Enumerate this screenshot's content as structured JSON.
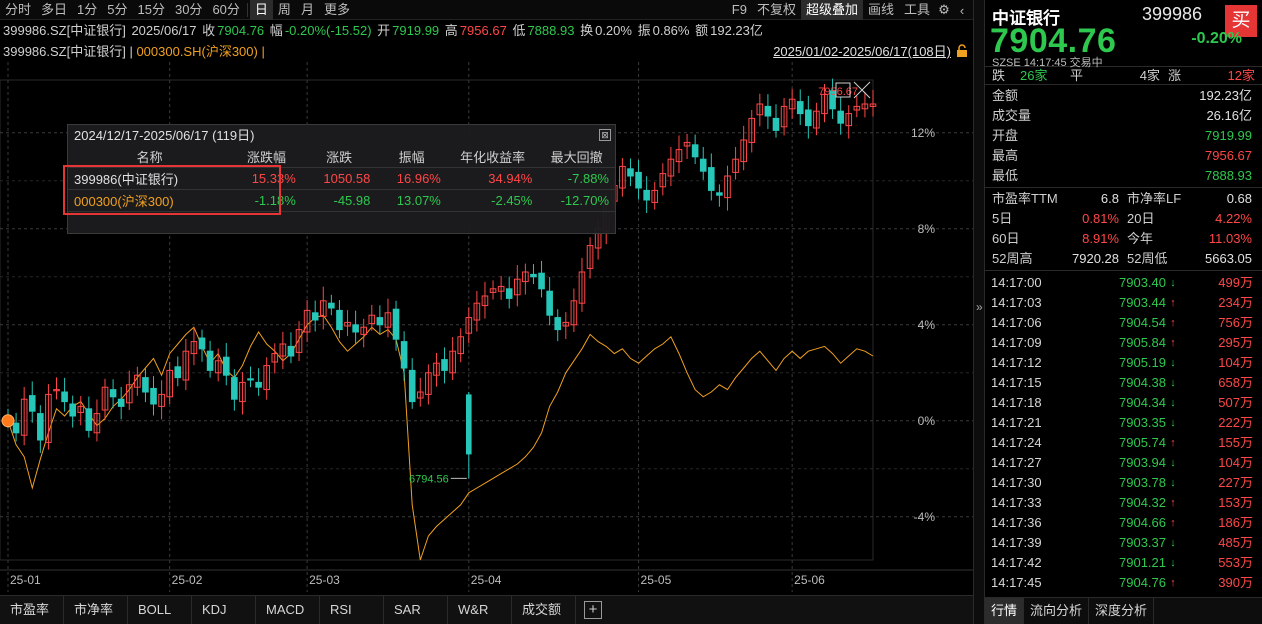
{
  "toolbar": {
    "periods": [
      "分时",
      "多日",
      "1分",
      "5分",
      "15分",
      "30分",
      "60分",
      "日",
      "周",
      "月",
      "更多"
    ],
    "active_period": "日",
    "right_items": [
      "F9",
      "不复权",
      "超级叠加",
      "画线",
      "工具"
    ],
    "active_right": "超级叠加"
  },
  "info": {
    "code": "399986.SZ[中证银行]",
    "date": "2025/06/17",
    "close_label": "收",
    "close_value": "7904.76",
    "change_label": "幅",
    "change_value": "-0.20%(-15.52)",
    "open_label": "开",
    "open_value": "7919.99",
    "high_label": "高",
    "high_value": "7956.67",
    "low_label": "低",
    "low_value": "7888.93",
    "turnover_label": "换",
    "turnover_value": "0.20%",
    "amplitude_label": "振",
    "amplitude_value": "0.86%",
    "amount_label": "额",
    "amount_value": "192.23亿"
  },
  "legend": {
    "main": "399986.SZ[中证银行]",
    "separator": " | ",
    "overlay": "000300.SH(沪深300)",
    "overlay_suffix": " |",
    "date_range": "2025/01/02-2025/06/17(108日)"
  },
  "stats_popup": {
    "title": "2024/12/17-2025/06/17 (119日)",
    "close_label": "⊠",
    "headers": [
      "名称",
      "涨跌幅",
      "涨跌",
      "振幅",
      "年化收益率",
      "最大回撤"
    ],
    "rows": [
      {
        "name": "399986(中证银行)",
        "change_pct": "15.33%",
        "change": "1050.58",
        "amplitude": "16.96%",
        "annual_return": "34.94%",
        "max_drawdown": "-7.88%"
      },
      {
        "name": "000300(沪深300)",
        "change_pct": "-1.18%",
        "change": "-45.98",
        "amplitude": "13.07%",
        "annual_return": "-2.45%",
        "max_drawdown": "-12.70%"
      }
    ]
  },
  "bottom_tabs": [
    "市盈率",
    "市净率",
    "BOLL",
    "KDJ",
    "MACD",
    "RSI",
    "SAR",
    "W&R",
    "成交额"
  ],
  "colors": {
    "up": "#ff4747",
    "down": "#2ec84f",
    "candle_down": "#26c6b8",
    "overlay_line": "#f0a020",
    "grid": "#3a3a3a"
  },
  "chart_data": {
    "type": "line",
    "title": "",
    "x_ticks": [
      "25-01",
      "25-02",
      "25-03",
      "25-04",
      "25-05",
      "25-06"
    ],
    "y_ticks": [
      "12%",
      "8%",
      "4%",
      "0%",
      "-4%"
    ],
    "ylim": [
      -5.8,
      14.2
    ],
    "annotations": {
      "high_label": "7956.67",
      "low_label": "6794.56"
    },
    "series": [
      {
        "name": "399986.SZ[中证银行]",
        "style": "candlestick",
        "values_pct": [
          0.0,
          -0.5,
          0.9,
          0.4,
          -0.8,
          1.1,
          1.3,
          0.8,
          0.2,
          0.6,
          -0.4,
          0.3,
          1.4,
          1.0,
          0.6,
          1.5,
          1.9,
          1.2,
          0.7,
          1.1,
          2.1,
          1.8,
          2.9,
          3.3,
          3.0,
          2.1,
          2.5,
          1.9,
          0.9,
          1.6,
          1.7,
          1.4,
          2.3,
          2.8,
          3.2,
          2.7,
          3.8,
          4.6,
          4.2,
          5.0,
          4.7,
          3.8,
          4.1,
          3.7,
          3.9,
          4.4,
          4.0,
          4.5,
          3.4,
          2.2,
          0.8,
          1.2,
          2.0,
          2.4,
          2.1,
          2.9,
          3.5,
          4.3,
          4.9,
          5.2,
          5.5,
          5.6,
          5.1,
          5.9,
          6.2,
          6.0,
          5.5,
          4.4,
          3.8,
          4.1,
          5.0,
          6.2,
          7.3,
          8.0,
          9.0,
          9.8,
          10.6,
          10.2,
          9.7,
          9.2,
          9.6,
          10.3,
          10.9,
          11.3,
          11.6,
          11.0,
          10.4,
          9.6,
          9.4,
          10.2,
          10.9,
          11.7,
          12.6,
          13.2,
          12.7,
          12.1,
          13.1,
          13.4,
          12.8,
          12.3,
          12.9,
          13.6,
          13.0,
          12.4,
          12.8,
          13.1,
          13.2,
          13.2
        ]
      },
      {
        "name": "000300.SH(沪深300)",
        "style": "line",
        "values_pct": [
          0.0,
          -1.0,
          -1.5,
          -2.8,
          -1.6,
          -0.5,
          0.5,
          0.2,
          0.6,
          0.8,
          0.3,
          -0.2,
          0.1,
          0.6,
          0.9,
          1.3,
          1.8,
          2.2,
          2.6,
          1.9,
          2.8,
          3.2,
          3.6,
          3.9,
          3.1,
          2.4,
          2.8,
          2.1,
          1.8,
          2.3,
          3.1,
          3.7,
          3.2,
          2.9,
          2.5,
          2.8,
          3.4,
          4.0,
          4.3,
          4.4,
          3.9,
          3.3,
          2.9,
          3.2,
          3.5,
          3.9,
          3.6,
          3.8,
          3.4,
          2.0,
          -3.5,
          -5.8,
          -4.8,
          -4.4,
          -4.1,
          -3.8,
          -3.5,
          -3.0,
          -2.8,
          -2.6,
          -2.4,
          -2.2,
          -2.0,
          -1.8,
          -1.5,
          -1.1,
          -0.5,
          0.6,
          1.2,
          2.0,
          2.5,
          3.0,
          3.6,
          3.3,
          3.1,
          2.8,
          3.0,
          2.6,
          2.4,
          2.7,
          3.0,
          3.2,
          3.5,
          2.8,
          2.0,
          1.3,
          1.0,
          1.2,
          1.5,
          1.3,
          1.8,
          2.2,
          2.6,
          2.9,
          2.5,
          2.1,
          2.6,
          2.9,
          2.6,
          2.9,
          3.0,
          3.1,
          2.8,
          2.4,
          2.7,
          3.0,
          2.9,
          2.7
        ]
      }
    ]
  },
  "quote": {
    "name": "中证银行",
    "code": "399986",
    "buy_label": "买",
    "price": "7904.76",
    "change_pct": "-0.20%",
    "sub": "SZSE  14:17:45  交易中",
    "breadth": {
      "down_label": "跌",
      "down_count": "26家",
      "flat_label": "平",
      "flat_count": "4家",
      "up_label": "涨",
      "up_count": "12家"
    },
    "fields": [
      {
        "k": "金额",
        "v": "192.23亿"
      },
      {
        "k": "成交量",
        "v": "26.16亿"
      },
      {
        "k": "开盘",
        "v": "7919.99"
      },
      {
        "k": "最高",
        "v": "7956.67"
      },
      {
        "k": "最低",
        "v": "7888.93"
      }
    ],
    "valuation": {
      "pe_label": "市盈率TTM",
      "pe": "6.8",
      "pb_label": "市净率LF",
      "pb": "0.68"
    },
    "returns": [
      [
        {
          "k": "5日",
          "v": "0.81%"
        },
        {
          "k": "20日",
          "v": "4.22%"
        }
      ],
      [
        {
          "k": "60日",
          "v": "8.91%"
        },
        {
          "k": "今年",
          "v": "11.03%"
        }
      ]
    ],
    "week52": {
      "high_label": "52周高",
      "high": "7920.28",
      "low_label": "52周低",
      "low": "5663.05"
    },
    "ticks": [
      {
        "time": "14:17:00",
        "price": "7903.40",
        "dir": "down",
        "vol": "499万"
      },
      {
        "time": "14:17:03",
        "price": "7903.44",
        "dir": "up",
        "vol": "234万"
      },
      {
        "time": "14:17:06",
        "price": "7904.54",
        "dir": "up",
        "vol": "756万"
      },
      {
        "time": "14:17:09",
        "price": "7905.84",
        "dir": "up",
        "vol": "295万"
      },
      {
        "time": "14:17:12",
        "price": "7905.19",
        "dir": "down",
        "vol": "104万"
      },
      {
        "time": "14:17:15",
        "price": "7904.38",
        "dir": "down",
        "vol": "658万"
      },
      {
        "time": "14:17:18",
        "price": "7904.34",
        "dir": "down",
        "vol": "507万"
      },
      {
        "time": "14:17:21",
        "price": "7903.35",
        "dir": "down",
        "vol": "222万"
      },
      {
        "time": "14:17:24",
        "price": "7905.74",
        "dir": "up",
        "vol": "155万"
      },
      {
        "time": "14:17:27",
        "price": "7903.94",
        "dir": "down",
        "vol": "104万"
      },
      {
        "time": "14:17:30",
        "price": "7903.78",
        "dir": "down",
        "vol": "227万"
      },
      {
        "time": "14:17:33",
        "price": "7904.32",
        "dir": "up",
        "vol": "153万"
      },
      {
        "time": "14:17:36",
        "price": "7904.66",
        "dir": "up",
        "vol": "186万"
      },
      {
        "time": "14:17:39",
        "price": "7903.37",
        "dir": "down",
        "vol": "485万"
      },
      {
        "time": "14:17:42",
        "price": "7901.21",
        "dir": "down",
        "vol": "553万"
      },
      {
        "time": "14:17:45",
        "price": "7904.76",
        "dir": "up",
        "vol": "390万"
      }
    ],
    "tabs": [
      "行情",
      "流向分析",
      "深度分析"
    ],
    "active_tab": "行情"
  }
}
